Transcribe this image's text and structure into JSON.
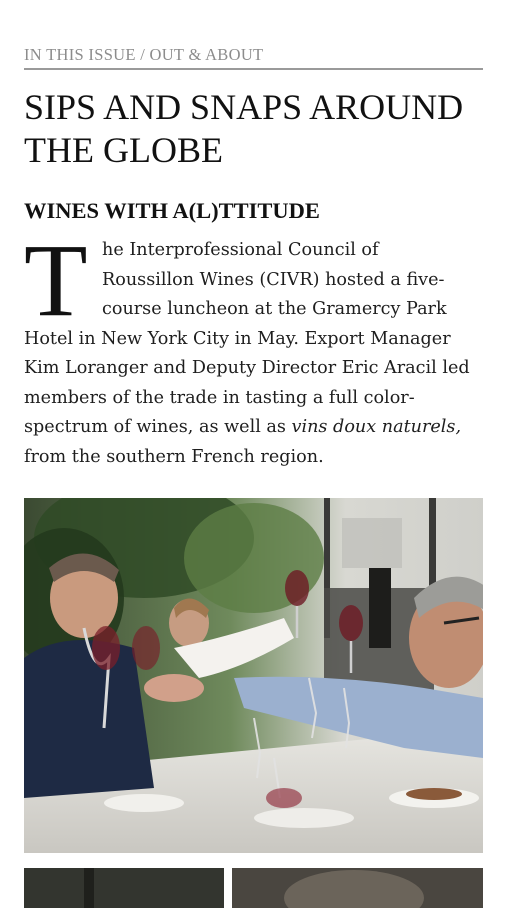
{
  "section_label": "IN THIS ISSUE / OUT & ABOUT",
  "headline": {
    "line1": "SIPS AND SNAPS AROUND",
    "line2": "THE GLOBE"
  },
  "article": {
    "subhead": "WINES WITH A(L)TTITUDE",
    "dropcap": "T",
    "lines": [
      "he Interprofessional Council of",
      "Roussillon Wines (CIVR) hosted a five-",
      "course luncheon at the Gramercy Park",
      "Hotel in New York City in May. Export Manager",
      "Kim Loranger and Deputy Director Eric Aracil led",
      "members of the trade in tasting a full color-",
      "spectrum of wines, as well as "
    ],
    "italic_phrase": "vins doux naturels,",
    "last_line": "from the southern French region."
  }
}
